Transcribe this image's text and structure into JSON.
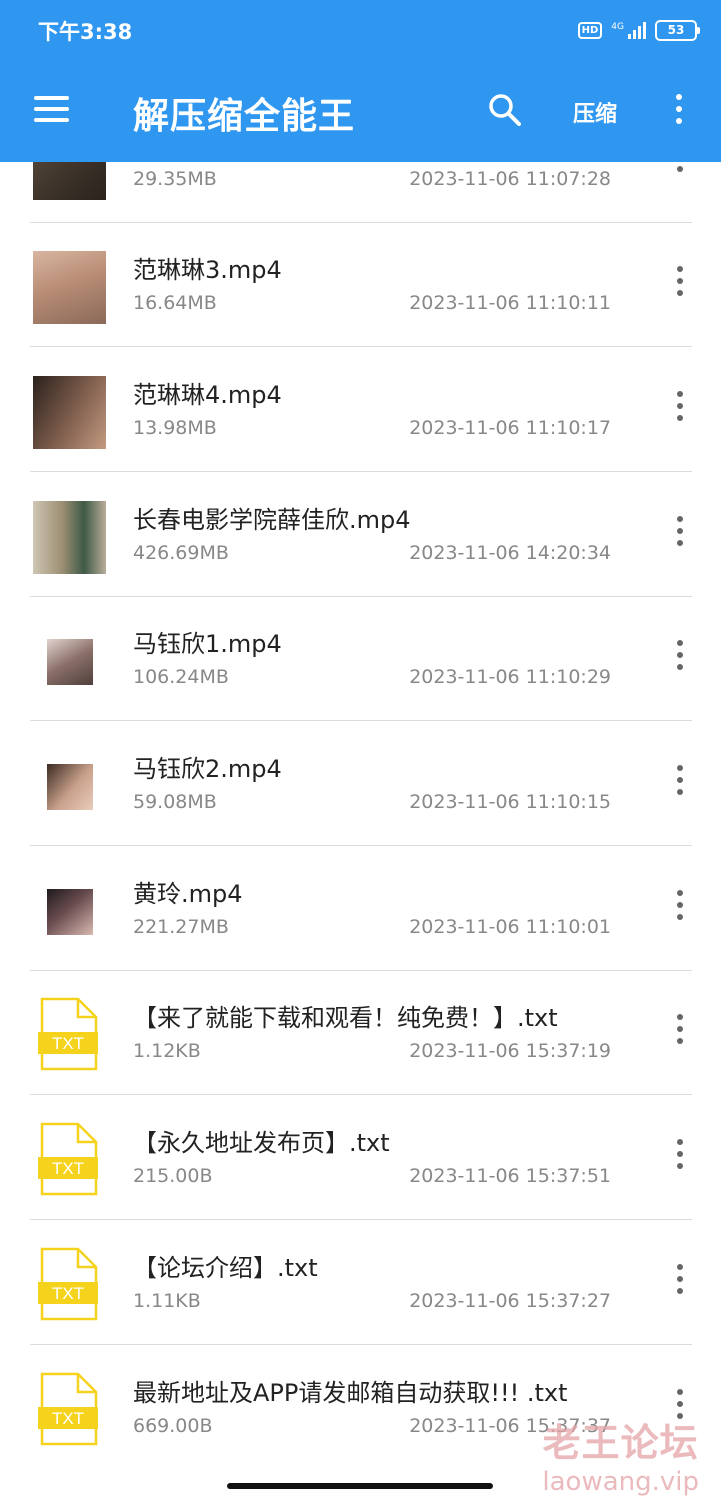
{
  "status_bar": {
    "time": "下午3:38",
    "hd": "HD",
    "network": "4G",
    "battery": "53"
  },
  "app_bar": {
    "title": "解压缩全能王",
    "compress_label": "压缩",
    "icons": [
      "menu-icon",
      "search-icon",
      "more-vert-icon"
    ]
  },
  "files": [
    {
      "name": "",
      "size": "29.35MB",
      "date": "2023-11-06 11:07:28",
      "type": "video"
    },
    {
      "name": "范琳琳3.mp4",
      "size": "16.64MB",
      "date": "2023-11-06 11:10:11",
      "type": "video"
    },
    {
      "name": "范琳琳4.mp4",
      "size": "13.98MB",
      "date": "2023-11-06 11:10:17",
      "type": "video"
    },
    {
      "name": "长春电影学院薛佳欣.mp4",
      "size": "426.69MB",
      "date": "2023-11-06 14:20:34",
      "type": "video"
    },
    {
      "name": "马钰欣1.mp4",
      "size": "106.24MB",
      "date": "2023-11-06 11:10:29",
      "type": "video"
    },
    {
      "name": "马钰欣2.mp4",
      "size": "59.08MB",
      "date": "2023-11-06 11:10:15",
      "type": "video"
    },
    {
      "name": "黄玲.mp4",
      "size": "221.27MB",
      "date": "2023-11-06 11:10:01",
      "type": "video"
    },
    {
      "name": "【来了就能下载和观看！纯免费！】.txt",
      "size": "1.12KB",
      "date": "2023-11-06 15:37:19",
      "type": "txt"
    },
    {
      "name": "【永久地址发布页】.txt",
      "size": "215.00B",
      "date": "2023-11-06 15:37:51",
      "type": "txt"
    },
    {
      "name": "【论坛介绍】.txt",
      "size": "1.11KB",
      "date": "2023-11-06 15:37:27",
      "type": "txt"
    },
    {
      "name": "最新地址及APP请发邮箱自动获取!!! .txt",
      "size": "669.00B",
      "date": "2023-11-06 15:37:37",
      "type": "txt"
    }
  ],
  "txt_icon_label": "TXT",
  "watermark": {
    "line1": "老王论坛",
    "line2": "laowang.vip"
  },
  "colors": {
    "app_bar": "#2f97f0",
    "txt_icon": "#f5d31d"
  }
}
